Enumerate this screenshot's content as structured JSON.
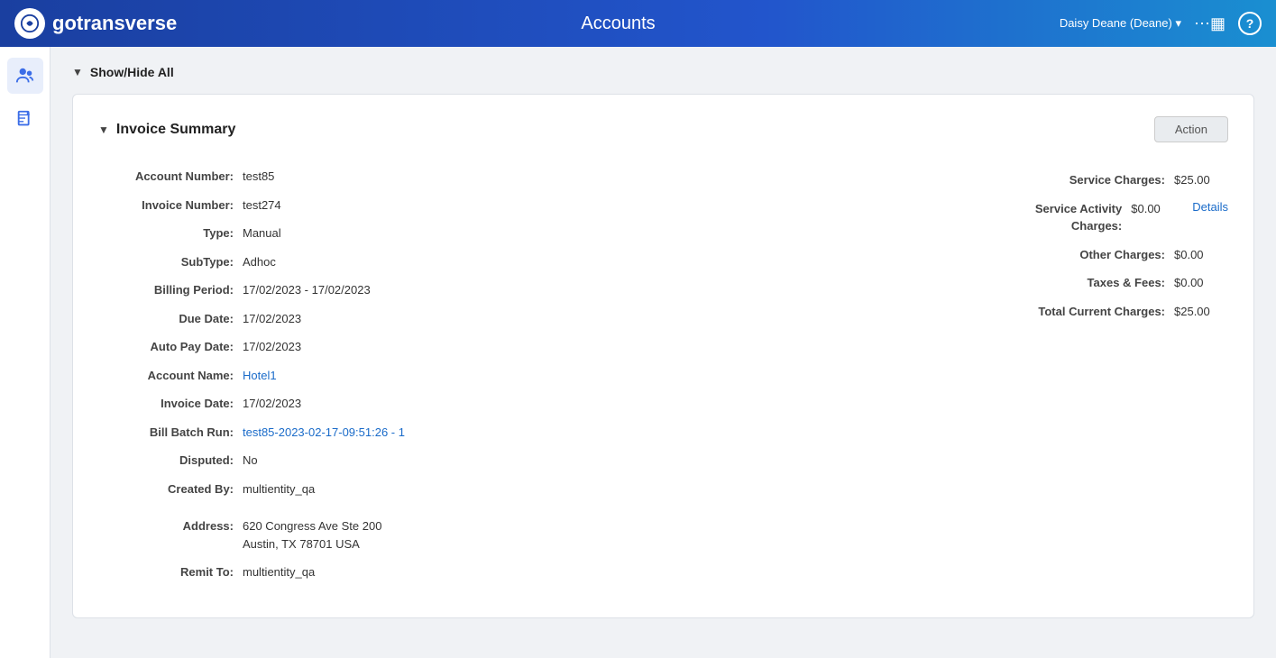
{
  "topnav": {
    "logo_text": "gotransverse",
    "title": "Accounts",
    "user": "Daisy Deane (Deane)",
    "user_dropdown": "▾"
  },
  "sidebar": {
    "items": [
      {
        "icon": "people-icon",
        "label": "Accounts",
        "active": true
      },
      {
        "icon": "document-icon",
        "label": "Documents",
        "active": false
      }
    ]
  },
  "show_hide_all": {
    "label": "Show/Hide All"
  },
  "invoice_summary": {
    "title": "Invoice Summary",
    "action_button": "Action",
    "fields": [
      {
        "label": "Account Number:",
        "value": "test85",
        "type": "text"
      },
      {
        "label": "Invoice Number:",
        "value": "test274",
        "type": "text"
      },
      {
        "label": "Type:",
        "value": "Manual",
        "type": "text"
      },
      {
        "label": "SubType:",
        "value": "Adhoc",
        "type": "text"
      },
      {
        "label": "Billing Period:",
        "value": "17/02/2023 - 17/02/2023",
        "type": "text"
      },
      {
        "label": "Due Date:",
        "value": "17/02/2023",
        "type": "text"
      },
      {
        "label": "Auto Pay Date:",
        "value": "17/02/2023",
        "type": "text"
      },
      {
        "label": "Account Name:",
        "value": "Hotel1",
        "type": "link"
      },
      {
        "label": "Invoice Date:",
        "value": "17/02/2023",
        "type": "text"
      },
      {
        "label": "Bill Batch Run:",
        "value": "test85-2023-02-17-09:51:26 - 1",
        "type": "link"
      },
      {
        "label": "Disputed:",
        "value": "No",
        "type": "text"
      },
      {
        "label": "Created By:",
        "value": "multientity_qa",
        "type": "text"
      },
      {
        "label": "Address:",
        "value": "620 Congress Ave Ste 200\nAustin, TX 78701 USA",
        "type": "address"
      },
      {
        "label": "Remit To:",
        "value": "multientity_qa",
        "type": "text"
      }
    ],
    "charges": [
      {
        "label": "Service Charges:",
        "value": "$25.00",
        "link": null
      },
      {
        "label": "Service Activity Charges:",
        "value": "$0.00",
        "link": "Details"
      },
      {
        "label": "Other Charges:",
        "value": "$0.00",
        "link": null
      },
      {
        "label": "Taxes & Fees:",
        "value": "$0.00",
        "link": null
      },
      {
        "label": "Total Current Charges:",
        "value": "$25.00",
        "link": null
      }
    ]
  }
}
